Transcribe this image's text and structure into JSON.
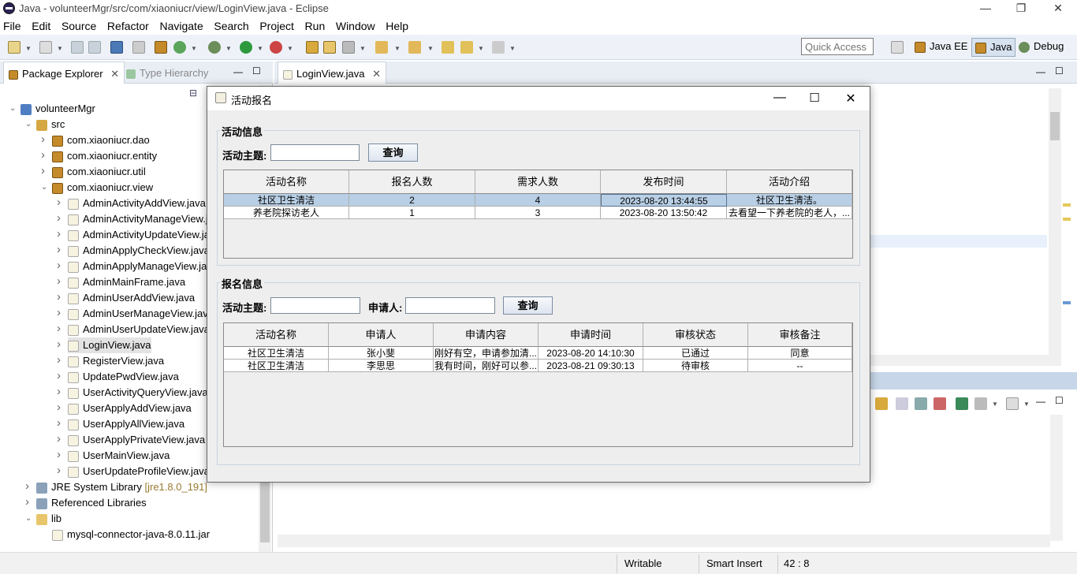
{
  "window": {
    "title": "Java - volunteerMgr/src/com/xiaoniucr/view/LoginView.java - Eclipse",
    "min": "—",
    "max": "❐",
    "close": "✕"
  },
  "menu": [
    "File",
    "Edit",
    "Source",
    "Refactor",
    "Navigate",
    "Search",
    "Project",
    "Run",
    "Window",
    "Help"
  ],
  "toolbar": {
    "quick_access": "Quick Access",
    "perspectives": [
      "Java EE",
      "Java",
      "Debug"
    ]
  },
  "left_pane": {
    "tabs": [
      "Package Explorer",
      "Type Hierarchy"
    ],
    "tree": [
      {
        "label": "volunteerMgr",
        "level": 0,
        "arrow": "v",
        "icon": "proj"
      },
      {
        "label": "src",
        "level": 1,
        "arrow": "v",
        "icon": "src"
      },
      {
        "label": "com.xiaoniucr.dao",
        "level": 2,
        "arrow": ">",
        "icon": "pkg"
      },
      {
        "label": "com.xiaoniucr.entity",
        "level": 2,
        "arrow": ">",
        "icon": "pkg"
      },
      {
        "label": "com.xiaoniucr.util",
        "level": 2,
        "arrow": ">",
        "icon": "pkg"
      },
      {
        "label": "com.xiaoniucr.view",
        "level": 2,
        "arrow": "v",
        "icon": "pkg"
      },
      {
        "label": "AdminActivityAddView.java",
        "level": 3,
        "arrow": ">",
        "icon": "j"
      },
      {
        "label": "AdminActivityManageView.j",
        "level": 3,
        "arrow": ">",
        "icon": "j"
      },
      {
        "label": "AdminActivityUpdateView.ja",
        "level": 3,
        "arrow": ">",
        "icon": "j"
      },
      {
        "label": "AdminApplyCheckView.java",
        "level": 3,
        "arrow": ">",
        "icon": "j"
      },
      {
        "label": "AdminApplyManageView.ja",
        "level": 3,
        "arrow": ">",
        "icon": "j"
      },
      {
        "label": "AdminMainFrame.java",
        "level": 3,
        "arrow": ">",
        "icon": "j"
      },
      {
        "label": "AdminUserAddView.java",
        "level": 3,
        "arrow": ">",
        "icon": "j"
      },
      {
        "label": "AdminUserManageView.jav",
        "level": 3,
        "arrow": ">",
        "icon": "j"
      },
      {
        "label": "AdminUserUpdateView.java",
        "level": 3,
        "arrow": ">",
        "icon": "j"
      },
      {
        "label": "LoginView.java",
        "level": 3,
        "arrow": ">",
        "icon": "j",
        "selected": true
      },
      {
        "label": "RegisterView.java",
        "level": 3,
        "arrow": ">",
        "icon": "j"
      },
      {
        "label": "UpdatePwdView.java",
        "level": 3,
        "arrow": ">",
        "icon": "j"
      },
      {
        "label": "UserActivityQueryView.java",
        "level": 3,
        "arrow": ">",
        "icon": "j"
      },
      {
        "label": "UserApplyAddView.java",
        "level": 3,
        "arrow": ">",
        "icon": "j"
      },
      {
        "label": "UserApplyAllView.java",
        "level": 3,
        "arrow": ">",
        "icon": "j"
      },
      {
        "label": "UserApplyPrivateView.java",
        "level": 3,
        "arrow": ">",
        "icon": "j"
      },
      {
        "label": "UserMainView.java",
        "level": 3,
        "arrow": ">",
        "icon": "j"
      },
      {
        "label": "UserUpdateProfileView.java",
        "level": 3,
        "arrow": ">",
        "icon": "j"
      },
      {
        "label": "JRE System Library",
        "suffix": " [jre1.8.0_191]",
        "level": 1,
        "arrow": ">",
        "icon": "lib"
      },
      {
        "label": "Referenced Libraries",
        "level": 1,
        "arrow": ">",
        "icon": "lib"
      },
      {
        "label": "lib",
        "level": 1,
        "arrow": "v",
        "icon": "fold"
      },
      {
        "label": "mysql-connector-java-8.0.11.jar",
        "level": 2,
        "arrow": "",
        "icon": "j"
      }
    ]
  },
  "editor": {
    "tab": "LoginView.java"
  },
  "status": {
    "writable": "Writable",
    "insert": "Smart Insert",
    "position": "42 : 8"
  },
  "dialog": {
    "title": "活动报名",
    "section1": {
      "legend": "活动信息",
      "label": "活动主题:",
      "input_value": "",
      "button": "查询",
      "columns": [
        "活动名称",
        "报名人数",
        "需求人数",
        "发布时间",
        "活动介绍"
      ],
      "rows": [
        [
          "社区卫生清洁",
          "2",
          "4",
          "2023-08-20 13:44:55",
          "社区卫生清洁。"
        ],
        [
          "养老院探访老人",
          "1",
          "3",
          "2023-08-20 13:50:42",
          "去看望一下养老院的老人，..."
        ]
      ]
    },
    "section2": {
      "legend": "报名信息",
      "label1": "活动主题:",
      "label2": "申请人:",
      "input1_value": "",
      "input2_value": "",
      "button": "查询",
      "columns": [
        "活动名称",
        "申请人",
        "申请内容",
        "申请时间",
        "审核状态",
        "审核备注"
      ],
      "rows": [
        [
          "社区卫生清洁",
          "张小斐",
          "刚好有空，申请参加清...",
          "2023-08-20 14:10:30",
          "已通过",
          "同意"
        ],
        [
          "社区卫生清洁",
          "李思思",
          "我有时间，刚好可以参...",
          "2023-08-21 09:30:13",
          "待审核",
          "--"
        ]
      ]
    }
  }
}
